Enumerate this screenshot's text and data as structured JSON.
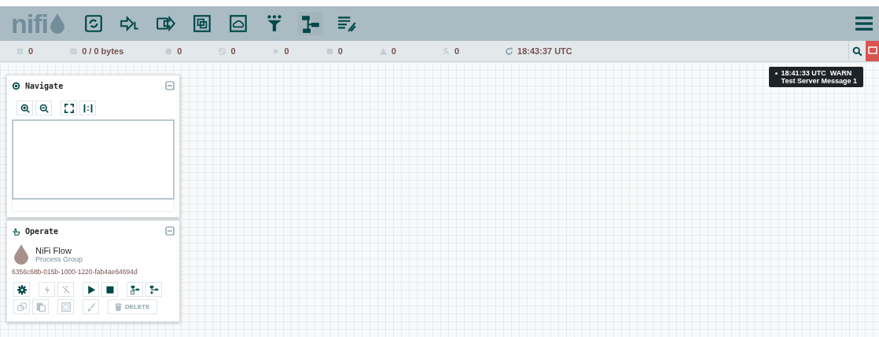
{
  "logo": {
    "text": "nifi"
  },
  "toolbar": [
    {
      "kind": "processor"
    },
    {
      "kind": "input-port"
    },
    {
      "kind": "output-port"
    },
    {
      "kind": "process-group"
    },
    {
      "kind": "remote-group"
    },
    {
      "kind": "funnel"
    },
    {
      "kind": "template"
    },
    {
      "kind": "label"
    }
  ],
  "status_bar": [
    {
      "kind": "nodes",
      "value": "0"
    },
    {
      "kind": "queue",
      "value": "0 / 0 bytes"
    },
    {
      "kind": "transmitting",
      "value": "0"
    },
    {
      "kind": "not-transmitting",
      "value": "0"
    },
    {
      "kind": "running",
      "value": "0"
    },
    {
      "kind": "stopped",
      "value": "0"
    },
    {
      "kind": "invalid",
      "value": "0"
    },
    {
      "kind": "disabled",
      "value": "0"
    },
    {
      "kind": "refresh",
      "value": "18:43:37 UTC"
    }
  ],
  "bulletin": {
    "time": "18:41:33 UTC",
    "level": "WARN",
    "message": "Test Server Message 1"
  },
  "navigate": {
    "title": "Navigate",
    "buttons": [
      {
        "kind": "zoom-in"
      },
      {
        "kind": "zoom-out"
      },
      {
        "kind": "fit"
      },
      {
        "kind": "actual"
      }
    ]
  },
  "operate": {
    "title": "Operate",
    "name": "NiFi Flow",
    "type": "Process Group",
    "id": "6356c68b-015b-1000-1220-fab4ae64694d",
    "row1": [
      {
        "kind": "gear",
        "disabled": false
      },
      {
        "kind": "enable",
        "disabled": true
      },
      {
        "kind": "disable",
        "disabled": true
      },
      {
        "kind": "start",
        "disabled": false
      },
      {
        "kind": "stop",
        "disabled": false
      },
      {
        "kind": "template-create",
        "disabled": false
      },
      {
        "kind": "template-upload",
        "disabled": false
      }
    ],
    "row2": [
      {
        "kind": "copy",
        "disabled": true
      },
      {
        "kind": "paste",
        "disabled": true
      },
      {
        "kind": "group",
        "disabled": true
      },
      {
        "kind": "color",
        "disabled": true
      }
    ],
    "delete": {
      "label": "DELETE",
      "disabled": true
    }
  }
}
